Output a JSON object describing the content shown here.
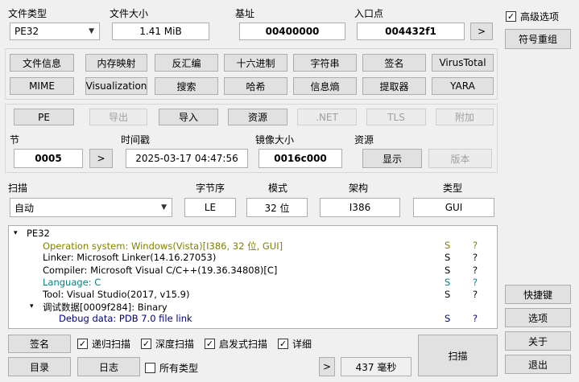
{
  "top": {
    "file_type_label": "文件类型",
    "file_type_value": "PE32",
    "file_size_label": "文件大小",
    "file_size_value": "1.41 MiB",
    "base_addr_label": "基址",
    "base_addr_value": "00400000",
    "entry_label": "入口点",
    "entry_value": "004432f1",
    "entry_goto": ">"
  },
  "right_panel": {
    "advanced_label": "高级选项",
    "advanced_checked": true,
    "symbol_button": "符号重组",
    "shortcuts_button": "快捷键",
    "options_button": "选项",
    "about_button": "关于",
    "exit_button": "退出"
  },
  "tools_row1": [
    "文件信息",
    "内存映射",
    "反汇编",
    "十六进制",
    "字符串",
    "签名",
    "VirusTotal"
  ],
  "tools_row2": [
    "MIME",
    "Visualization",
    "搜索",
    "哈希",
    "信息熵",
    "提取器",
    "YARA"
  ],
  "pe_row": {
    "buttons": [
      {
        "label": "PE",
        "enabled": true
      },
      {
        "label": "导出",
        "enabled": false
      },
      {
        "label": "导入",
        "enabled": true
      },
      {
        "label": "资源",
        "enabled": true
      },
      {
        "label": ".NET",
        "enabled": false
      },
      {
        "label": "TLS",
        "enabled": false
      },
      {
        "label": "附加",
        "enabled": false
      }
    ],
    "section_label": "节",
    "section_value": "0005",
    "section_goto": ">",
    "timestamp_label": "时间戳",
    "timestamp_value": "2025-03-17 04:47:56",
    "image_size_label": "镜像大小",
    "image_size_value": "0016c000",
    "resources_label": "资源",
    "show_button": "显示",
    "version_button": "版本"
  },
  "scan_info": {
    "scan_label": "扫描",
    "scan_mode_value": "自动",
    "endian_label": "字节序",
    "endian_value": "LE",
    "mode_label": "模式",
    "mode_value": "32 位",
    "arch_label": "架构",
    "arch_value": "I386",
    "type_label": "类型",
    "type_value": "GUI"
  },
  "results": [
    {
      "indent": 0,
      "expander": "▾",
      "text": "PE32",
      "s": "",
      "q": "",
      "color": "#000000"
    },
    {
      "indent": 1,
      "expander": "",
      "text": "Operation system: Windows(Vista)[I386, 32 位, GUI]",
      "s": "S",
      "q": "?",
      "color": "#808000"
    },
    {
      "indent": 1,
      "expander": "",
      "text": "Linker: Microsoft Linker(14.16.27053)",
      "s": "S",
      "q": "?",
      "color": "#000000"
    },
    {
      "indent": 1,
      "expander": "",
      "text": "Compiler: Microsoft Visual C/C++(19.36.34808)[C]",
      "s": "S",
      "q": "?",
      "color": "#000000"
    },
    {
      "indent": 1,
      "expander": "",
      "text": "Language: C",
      "s": "S",
      "q": "?",
      "color": "#008080"
    },
    {
      "indent": 1,
      "expander": "",
      "text": "Tool: Visual Studio(2017, v15.9)",
      "s": "S",
      "q": "?",
      "color": "#000000"
    },
    {
      "indent": 1,
      "expander": "▾",
      "text": "调试数据[0009f284]: Binary",
      "s": "",
      "q": "",
      "color": "#000000"
    },
    {
      "indent": 2,
      "expander": "",
      "text": "Debug data: PDB 7.0 file link",
      "s": "S",
      "q": "?",
      "color": "#000080"
    }
  ],
  "bottom": {
    "signature_button": "签名",
    "recursive_label": "递归扫描",
    "recursive_checked": true,
    "deep_label": "深度扫描",
    "deep_checked": true,
    "heuristic_label": "启发式扫描",
    "heuristic_checked": true,
    "verbose_label": "详细",
    "verbose_checked": true,
    "directory_button": "目录",
    "log_button": "日志",
    "all_types_label": "所有类型",
    "all_types_checked": false,
    "more_button": ">",
    "time_value": "437 毫秒",
    "scan_button": "扫描"
  },
  "colors": {
    "window_bg": "#f0f0f0",
    "button_bg": "#e1e1e1",
    "disabled_text": "#a0a0a0"
  }
}
